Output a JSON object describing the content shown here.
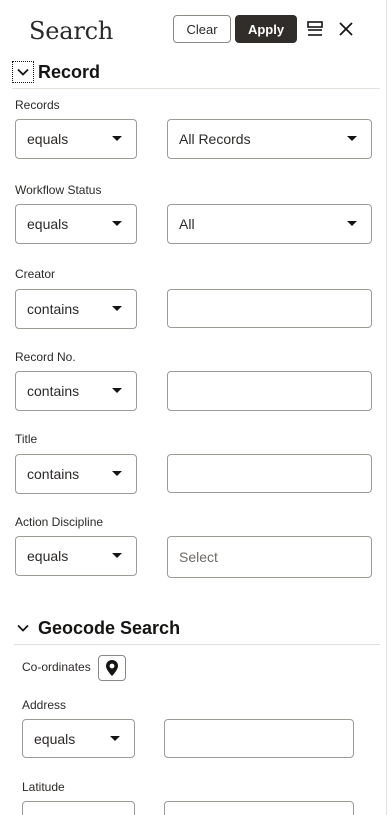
{
  "header": {
    "title": "Search",
    "clear_label": "Clear",
    "apply_label": "Apply"
  },
  "record_section": {
    "title": "Record",
    "fields": {
      "records": {
        "label": "Records",
        "operator": "equals",
        "value": "All Records"
      },
      "workflow_status": {
        "label": "Workflow Status",
        "operator": "equals",
        "value": "All"
      },
      "creator": {
        "label": "Creator",
        "operator": "contains",
        "value": ""
      },
      "record_no": {
        "label": "Record No.",
        "operator": "contains",
        "value": ""
      },
      "title": {
        "label": "Title",
        "operator": "contains",
        "value": ""
      },
      "action_discipline": {
        "label": "Action Discipline",
        "operator": "equals",
        "placeholder": "Select"
      }
    }
  },
  "geocode_section": {
    "title": "Geocode Search",
    "coordinates_label": "Co-ordinates",
    "address": {
      "label": "Address",
      "operator": "equals",
      "value": ""
    },
    "latitude": {
      "label": "Latitude"
    }
  },
  "colors": {
    "apply_bg": "#312d2a",
    "border": "#9e9a96",
    "text": "#161513"
  }
}
